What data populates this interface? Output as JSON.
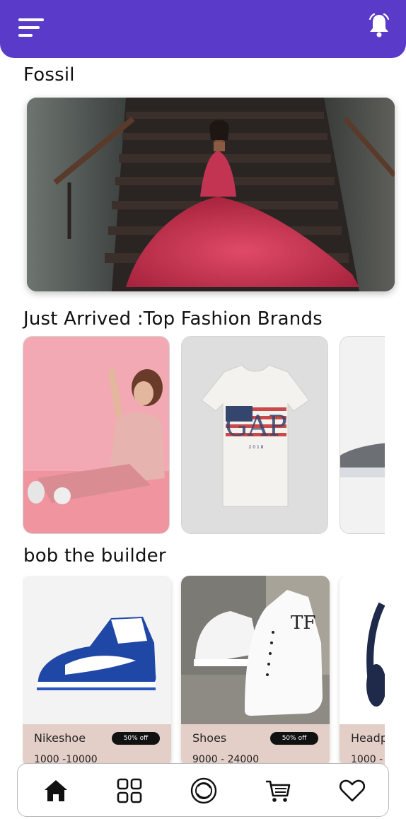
{
  "colors": {
    "header": "#5a3bc9",
    "info_bg": "#e4cfc8",
    "badge": "#111111"
  },
  "header": {
    "menu_icon": "menu-icon",
    "notification_icon": "bell-icon"
  },
  "sections": {
    "featured": {
      "title": "Fossil"
    },
    "brands": {
      "title": "Just Arrived :Top Fashion Brands"
    },
    "products": {
      "title": "bob the builder"
    }
  },
  "products": [
    {
      "name": "Nikeshoe",
      "discount": "50% off",
      "price": "1000 -10000"
    },
    {
      "name": "Shoes",
      "discount": "50% off",
      "price": "9000 - 24000"
    },
    {
      "name": "Headp",
      "price": "1000 -"
    }
  ],
  "bottom_nav": [
    {
      "icon": "home-icon"
    },
    {
      "icon": "grid-icon"
    },
    {
      "icon": "circle-icon"
    },
    {
      "icon": "cart-icon"
    },
    {
      "icon": "heart-icon"
    }
  ]
}
